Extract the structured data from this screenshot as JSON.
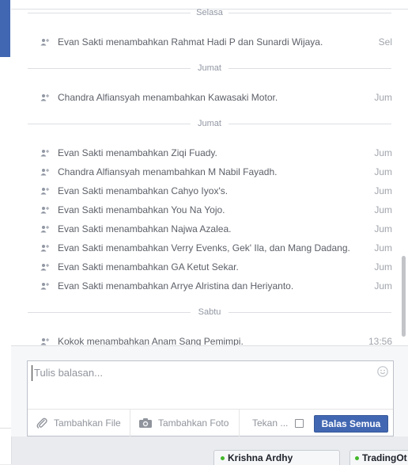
{
  "thread": {
    "separators": [
      {
        "label": "Selasa"
      },
      {
        "label": "Jumat"
      },
      {
        "label": "Jumat"
      },
      {
        "label": "Sabtu"
      }
    ],
    "events": [
      {
        "text": "Evan Sakti menambahkan Rahmat Hadi P dan Sunardi Wijaya.",
        "time": "Sel"
      },
      {
        "text": "Chandra Alfiansyah menambahkan Kawasaki Motor.",
        "time": "Jum"
      },
      {
        "text": "Evan Sakti menambahkan Ziqi Fuady.",
        "time": "Jum"
      },
      {
        "text": "Chandra Alfiansyah menambahkan M Nabil Fayadh.",
        "time": "Jum"
      },
      {
        "text": "Evan Sakti menambahkan Cahyo Iyox's.",
        "time": "Jum"
      },
      {
        "text": "Evan Sakti menambahkan You Na Yojo.",
        "time": "Jum"
      },
      {
        "text": "Evan Sakti menambahkan Najwa Azalea.",
        "time": "Jum"
      },
      {
        "text": "Evan Sakti menambahkan Verry Evenks, Gek' Ila, dan Mang Dadang.",
        "time": "Jum"
      },
      {
        "text": "Evan Sakti menambahkan GA Ketut Sekar.",
        "time": "Jum"
      },
      {
        "text": "Evan Sakti menambahkan Arrye Alristina dan Heriyanto.",
        "time": "Jum"
      },
      {
        "text": "Kokok menambahkan Anam Sang Pemimpi.",
        "time": "13:56"
      }
    ],
    "event_icon": "add-person-icon"
  },
  "composer": {
    "placeholder": "Tulis balasan...",
    "add_file": "Tambahkan File",
    "add_photo": "Tambahkan Foto",
    "press_enter": "Tekan ...",
    "send_all": "Balas Semua"
  },
  "chat_tabs": [
    {
      "name": "Krishna Ardhy"
    },
    {
      "name": "TradingOt"
    }
  ],
  "colors": {
    "accent": "#4267b2",
    "online": "#42b72a"
  }
}
